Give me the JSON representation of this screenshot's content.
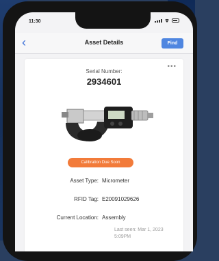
{
  "status": {
    "time": "11:30"
  },
  "nav": {
    "back_icon": "‹",
    "title": "Asset Details",
    "find_label": "Find"
  },
  "asset": {
    "serial_label": "Serial Number:",
    "serial_value": "2934601",
    "badge": "Calibration Due Soon",
    "badge_color": "#f27b3a",
    "fields": [
      {
        "label": "Asset Type:",
        "value": "Micrometer"
      },
      {
        "label": "RFID Tag:",
        "value": "E20091029626"
      },
      {
        "label": "Current Location:",
        "value": "Assembly"
      }
    ],
    "last_seen": "Last seen: Mar 1, 2023 5:09PM"
  },
  "colors": {
    "accent": "#4f86e0"
  }
}
